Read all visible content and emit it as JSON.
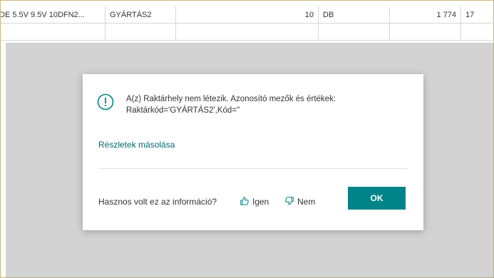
{
  "grid": {
    "rows": [
      [
        "DE 5.5V 9.5V 10DFN2...",
        "GYÁRTÁS2",
        "10",
        "DB",
        "1 774",
        "17"
      ],
      [
        "",
        "",
        "",
        "",
        "",
        ""
      ]
    ]
  },
  "dialog": {
    "message_line1": "A(z) Raktárhely nem létezik. Azonosító mezők és értékek:",
    "message_line2": "Raktárkód='GYÁRTÁS2',Kód=''",
    "copy_details": "Részletek másolása",
    "feedback_question": "Hasznos volt ez az információ?",
    "yes_label": "Igen",
    "no_label": "Nem",
    "ok_label": "OK"
  },
  "icons": {
    "info": "info-circle-icon",
    "thumbs_up": "thumbs-up-icon",
    "thumbs_down": "thumbs-down-icon"
  },
  "colors": {
    "accent": "#008489",
    "link": "#00686b"
  }
}
